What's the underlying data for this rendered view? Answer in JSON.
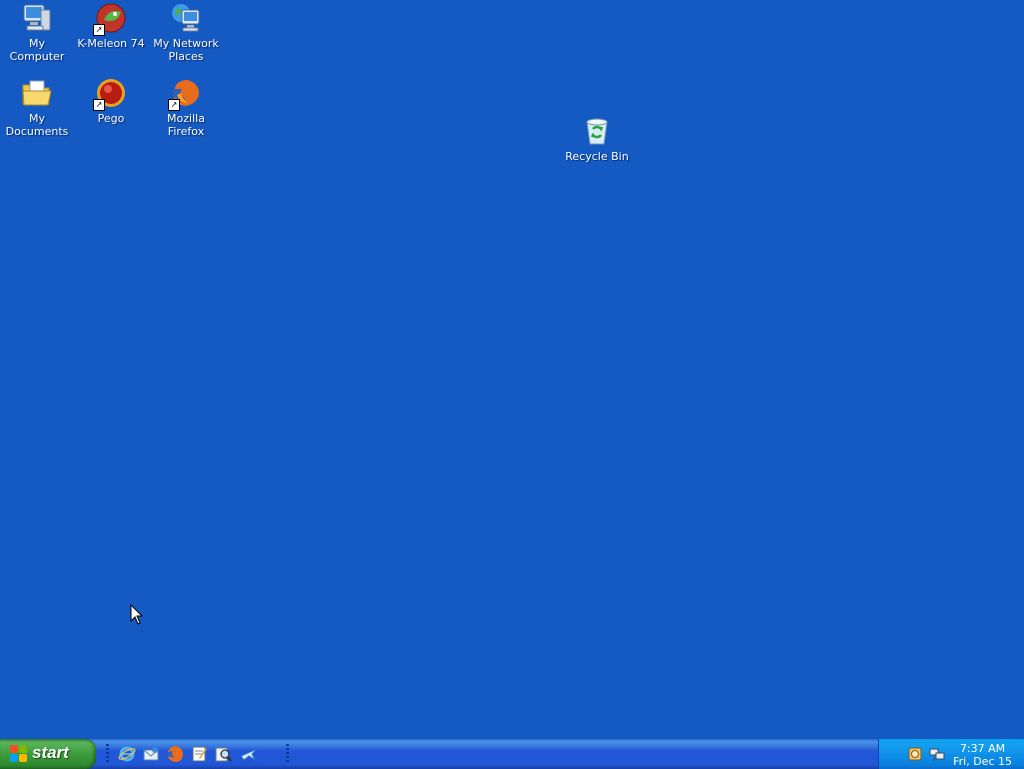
{
  "desktop": {
    "icons": [
      {
        "label": "My Computer",
        "icon": "my-computer-icon"
      },
      {
        "label": "K-Meleon 74",
        "icon": "k-meleon-icon",
        "shortcut": true
      },
      {
        "label": "My Network Places",
        "icon": "network-places-icon"
      },
      {
        "label": "My Documents",
        "icon": "my-documents-icon"
      },
      {
        "label": "Pego",
        "icon": "pego-icon",
        "shortcut": true
      },
      {
        "label": "Mozilla Firefox",
        "icon": "firefox-icon",
        "shortcut": true
      },
      {
        "label": "Recycle Bin",
        "icon": "recycle-bin-icon"
      }
    ]
  },
  "taskbar": {
    "start_label": "start",
    "quick_launch": [
      "internet-explorer-icon",
      "outlook-express-icon",
      "firefox-icon",
      "notepad-icon",
      "search-icon",
      "messenger-icon"
    ],
    "tray": {
      "icons": [
        "speaker-icon",
        "network-icon"
      ],
      "time": "7:37 AM",
      "date": "Fri, Dec 15"
    }
  },
  "colors": {
    "desktop": "#1559c3",
    "taskbar": "#2157d7",
    "start": "#3d9c3d",
    "tray": "#0b83e1"
  }
}
